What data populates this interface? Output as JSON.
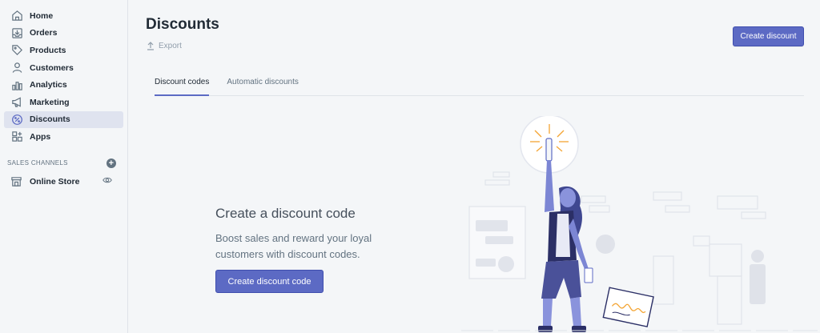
{
  "sidebar": {
    "items": [
      {
        "label": "Home",
        "icon": "home-icon",
        "active": false
      },
      {
        "label": "Orders",
        "icon": "orders-icon",
        "active": false
      },
      {
        "label": "Products",
        "icon": "tag-icon",
        "active": false
      },
      {
        "label": "Customers",
        "icon": "person-icon",
        "active": false
      },
      {
        "label": "Analytics",
        "icon": "bar-chart-icon",
        "active": false
      },
      {
        "label": "Marketing",
        "icon": "megaphone-icon",
        "active": false
      },
      {
        "label": "Discounts",
        "icon": "discount-icon",
        "active": true
      },
      {
        "label": "Apps",
        "icon": "apps-icon",
        "active": false
      }
    ],
    "section_title": "SALES CHANNELS",
    "channel": {
      "label": "Online Store",
      "icon": "store-icon"
    }
  },
  "header": {
    "title": "Discounts",
    "export_label": "Export",
    "create_button": "Create discount"
  },
  "tabs": [
    {
      "label": "Discount codes",
      "active": true
    },
    {
      "label": "Automatic discounts",
      "active": false
    }
  ],
  "empty_state": {
    "title": "Create a discount code",
    "description": "Boost sales and reward your loyal customers with discount codes.",
    "button": "Create discount code"
  },
  "colors": {
    "accent": "#5c6ac4",
    "sidebar_bg": "#f4f6f8",
    "active_item_bg": "#dfe3ef"
  }
}
